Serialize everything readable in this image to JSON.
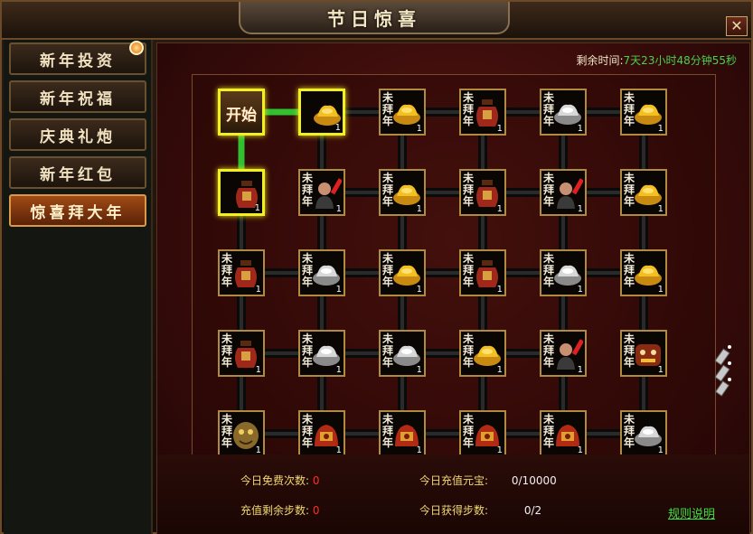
{
  "window": {
    "title": "节日惊喜",
    "close_glyph": "✕"
  },
  "sidebar": {
    "items": [
      {
        "label": "新年投资",
        "active": false
      },
      {
        "label": "新年祝福",
        "active": false
      },
      {
        "label": "庆典礼炮",
        "active": false
      },
      {
        "label": "新年红包",
        "active": false
      },
      {
        "label": "惊喜拜大年",
        "active": true
      }
    ]
  },
  "timer": {
    "label": "剩余时间:",
    "value": "7天23小时48分钟55秒"
  },
  "board": {
    "start_label": "开始",
    "veil_text": "未拜年",
    "rows": [
      [
        {
          "kind": "start",
          "state": "done"
        },
        {
          "item": "gold-ingot",
          "count": "1",
          "state": "done"
        },
        {
          "item": "gold-ingot",
          "count": "1",
          "state": "hidden"
        },
        {
          "item": "wine-jar",
          "count": "1",
          "state": "hidden"
        },
        {
          "item": "silver-ingot",
          "count": "1",
          "state": "hidden"
        },
        {
          "item": "gold-ingot",
          "count": "1",
          "state": "hidden"
        }
      ],
      [
        {
          "item": "wine-jar",
          "count": "1",
          "state": "done"
        },
        {
          "item": "firecracker-figure",
          "count": "1",
          "state": "hidden"
        },
        {
          "item": "gold-ingot",
          "count": "1",
          "state": "hidden"
        },
        {
          "item": "wine-jar",
          "count": "1",
          "state": "hidden"
        },
        {
          "item": "firecracker-figure",
          "count": "1",
          "state": "hidden"
        },
        {
          "item": "gold-ingot",
          "count": "1",
          "state": "hidden"
        }
      ],
      [
        {
          "item": "wine-jar",
          "count": "1",
          "state": "hidden"
        },
        {
          "item": "silver-ingot",
          "count": "1",
          "state": "hidden"
        },
        {
          "item": "gold-ingot",
          "count": "1",
          "state": "hidden"
        },
        {
          "item": "wine-jar",
          "count": "1",
          "state": "hidden"
        },
        {
          "item": "silver-ingot",
          "count": "1",
          "state": "hidden"
        },
        {
          "item": "gold-ingot",
          "count": "1",
          "state": "hidden"
        }
      ],
      [
        {
          "item": "wine-jar",
          "count": "1",
          "state": "hidden"
        },
        {
          "item": "silver-ingot",
          "count": "1",
          "state": "hidden"
        },
        {
          "item": "silver-ingot",
          "count": "1",
          "state": "hidden"
        },
        {
          "item": "gold-ingot",
          "count": "1",
          "state": "hidden"
        },
        {
          "item": "firecracker-figure",
          "count": "1",
          "state": "hidden"
        },
        {
          "item": "lion-dance",
          "count": "1",
          "state": "hidden"
        }
      ],
      [
        {
          "item": "nian-beast",
          "count": "1",
          "state": "hidden"
        },
        {
          "item": "red-treasure",
          "count": "1",
          "state": "hidden"
        },
        {
          "item": "red-treasure",
          "count": "1",
          "state": "hidden"
        },
        {
          "item": "red-treasure",
          "count": "1",
          "state": "hidden"
        },
        {
          "item": "red-treasure",
          "count": "1",
          "state": "hidden"
        },
        {
          "item": "silver-ingot",
          "count": "1",
          "state": "hidden"
        }
      ]
    ]
  },
  "stats": {
    "free_times_label": "今日免费次数:",
    "free_times_value": "0",
    "recharge_label": "今日充值元宝:",
    "recharge_value": "0/10000",
    "remaining_steps_label": "充值剩余步数:",
    "remaining_steps_value": "0",
    "earned_steps_label": "今日获得步数:",
    "earned_steps_value": "0/2"
  },
  "rules_link": "规则说明",
  "colors": {
    "highlight": "#f2f020",
    "path_done": "#30c030",
    "timer_value": "#4cd04c",
    "stat_label": "#f0d870"
  }
}
